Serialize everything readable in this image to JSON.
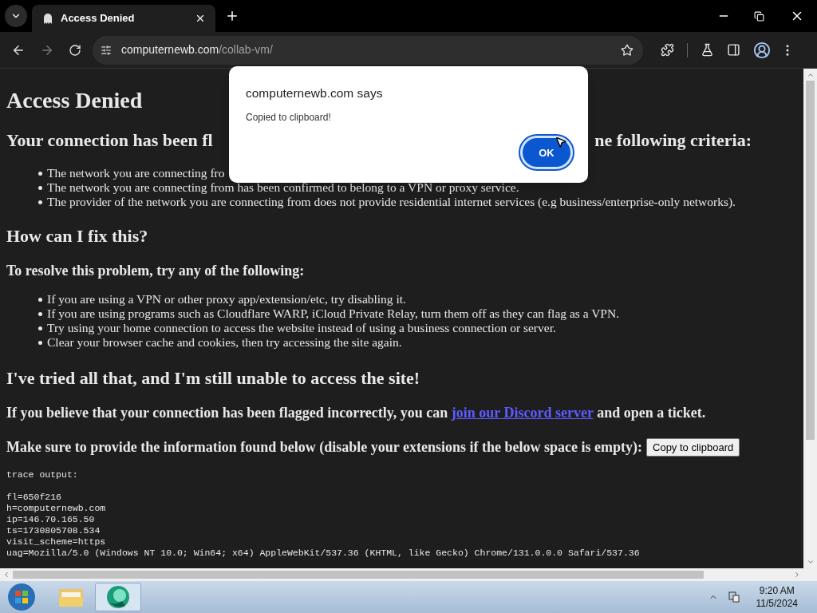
{
  "tabs": [
    {
      "title": "Access Denied",
      "selected": true
    }
  ],
  "address": {
    "domain": "computernewb.com",
    "path": "/collab-vm/"
  },
  "page": {
    "title": "Access Denied",
    "flagged_heading": {
      "left": "Your connection has been fl",
      "right": "ne following criteria:"
    },
    "criteria": [
      "The network you are connecting fro",
      "The network you are connecting from has been confirmed to belong to a VPN or proxy service.",
      "The provider of the network you are connecting from does not provide residential internet services (e.g business/enterprise-only networks)."
    ],
    "fix_heading": "How can I fix this?",
    "resolve_heading": "To resolve this problem, try any of the following:",
    "fixes": [
      "If you are using a VPN or other proxy app/extension/etc, try disabling it.",
      "If you are using programs such as Cloudflare WARP, iCloud Private Relay, turn them off as they can flag as a VPN.",
      "Try using your home connection to access the website instead of using a business connection or server.",
      "Clear your browser cache and cookies, then try accessing the site again."
    ],
    "tried_heading": "I've tried all that, and I'm still unable to access the site!",
    "flagged_line": {
      "before": "If you believe that your connection has been flagged incorrectly, you can",
      "link": "join our Discord server",
      "after": "and open a ticket."
    },
    "provide_line": "Make sure to provide the information found below (disable your extensions if the below space is empty):",
    "copy_button": "Copy to clipboard",
    "trace": [
      "trace output:",
      "fl=650f216",
      "h=computernewb.com",
      "ip=146.70.165.50",
      "ts=1730805708.534",
      "visit_scheme=https",
      "uag=Mozilla/5.0 (Windows NT 10.0; Win64; x64) AppleWebKit/537.36 (KHTML, like Gecko) Chrome/131.0.0.0 Safari/537.36"
    ]
  },
  "dialog": {
    "title": "computernewb.com says",
    "message": "Copied to clipboard!",
    "ok": "OK"
  },
  "taskbar": {
    "time": "9:20 AM",
    "date": "11/5/2024"
  }
}
